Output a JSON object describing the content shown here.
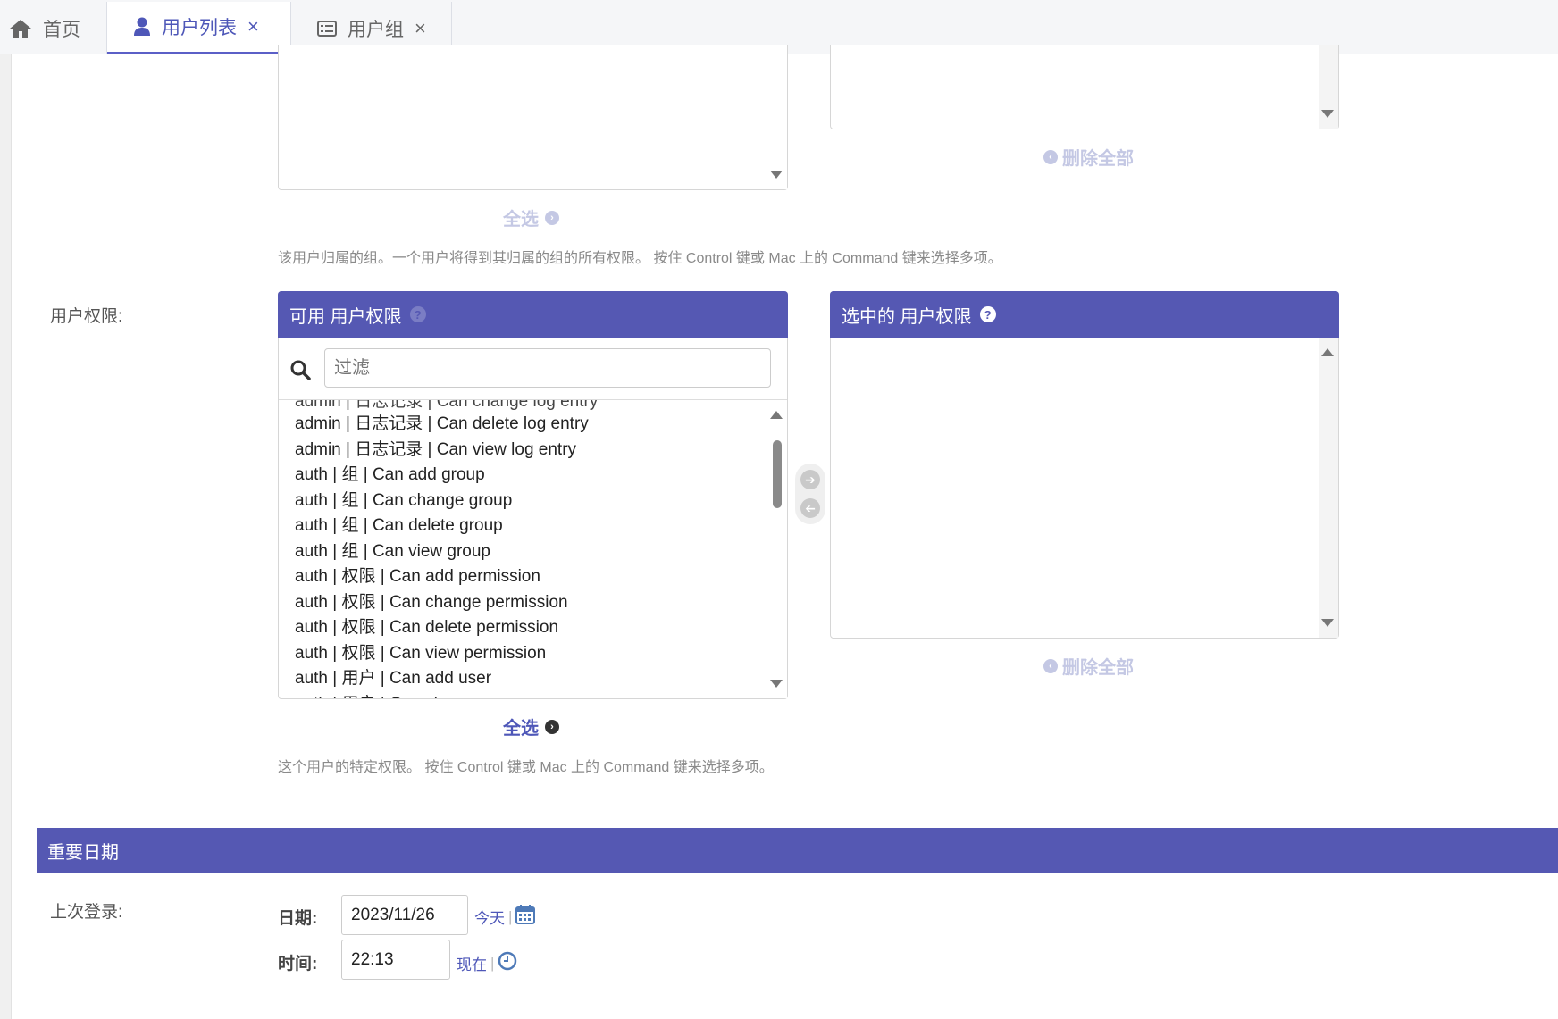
{
  "tabs": [
    {
      "label": "首页",
      "icon": "home-icon",
      "closable": false,
      "active": false
    },
    {
      "label": "用户列表",
      "icon": "user-icon",
      "closable": true,
      "active": true
    },
    {
      "label": "用户组",
      "icon": "table-list-icon",
      "closable": true,
      "active": false
    }
  ],
  "tab_close_glyph": "×",
  "groups_widget": {
    "select_all_label": "全选",
    "remove_all_label": "删除全部",
    "help_text": "该用户归属的组。一个用户将得到其归属的组的所有权限。 按住 Control 键或 Mac 上的 Command 键来选择多项。"
  },
  "permissions_widget": {
    "field_label": "用户权限:",
    "available_title": "可用 用户权限",
    "chosen_title": "选中的 用户权限",
    "filter_placeholder": "过滤",
    "available_options": [
      "admin | 日志记录 | Can delete log entry",
      "admin | 日志记录 | Can view log entry",
      "auth | 组 | Can add group",
      "auth | 组 | Can change group",
      "auth | 组 | Can delete group",
      "auth | 组 | Can view group",
      "auth | 权限 | Can add permission",
      "auth | 权限 | Can change permission",
      "auth | 权限 | Can delete permission",
      "auth | 权限 | Can view permission",
      "auth | 用户 | Can add user",
      "auth | 用户 | Can change user"
    ],
    "partial_top_option": "admin | 日志记录 | Can change log entry",
    "select_all_label": "全选",
    "remove_all_label": "删除全部",
    "help_text": "这个用户的特定权限。 按住 Control 键或 Mac 上的 Command 键来选择多项。"
  },
  "important_dates": {
    "section_title": "重要日期",
    "last_login_label": "上次登录:",
    "date_label": "日期:",
    "date_value": "2023/11/26",
    "today_link": "今天",
    "time_label": "时间:",
    "time_value": "22:13",
    "now_link": "现在",
    "separator": "|"
  },
  "colors": {
    "accent": "#5558b3",
    "link": "#4e57b8",
    "disabled_link": "#c4c8e4"
  }
}
